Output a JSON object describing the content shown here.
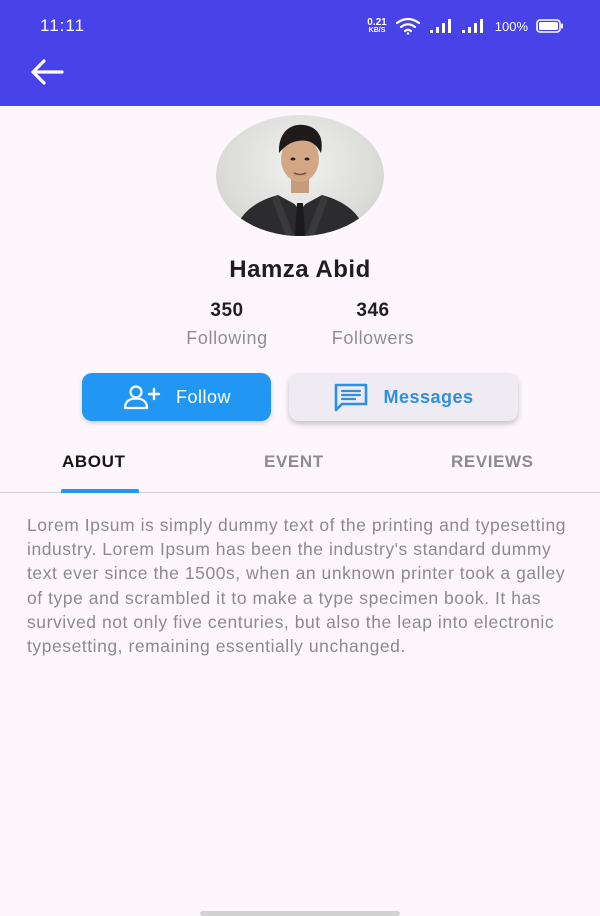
{
  "status_bar": {
    "time": "11:11",
    "net_speed_value": "0.21",
    "net_speed_unit": "KB/S",
    "battery": "100%",
    "icons": [
      "wifi-icon",
      "signal-icon",
      "signal-icon",
      "battery-icon"
    ]
  },
  "header": {
    "back_icon": "arrow-left-icon",
    "color": "#4743e9"
  },
  "profile": {
    "name": "Hamza Abid",
    "stats": [
      {
        "value": "350",
        "label": "Following"
      },
      {
        "value": "346",
        "label": "Followers"
      }
    ]
  },
  "actions": {
    "follow": {
      "label": "Follow",
      "icon": "add-user-icon",
      "color": "#2196f3"
    },
    "messages": {
      "label": "Messages",
      "icon": "message-icon",
      "color": "#efebf2"
    }
  },
  "tabs": [
    {
      "label": "ABOUT",
      "active": true
    },
    {
      "label": "EVENT",
      "active": false
    },
    {
      "label": "REVIEWS",
      "active": false
    }
  ],
  "about": {
    "text": "Lorem Ipsum is simply dummy text of the printing and typesetting industry. Lorem Ipsum has been the industry's standard dummy text ever since the 1500s, when an unknown printer took a galley of type and scrambled it to make a type specimen book. It has survived not only five centuries, but also the leap into electronic typesetting, remaining essentially unchanged."
  }
}
